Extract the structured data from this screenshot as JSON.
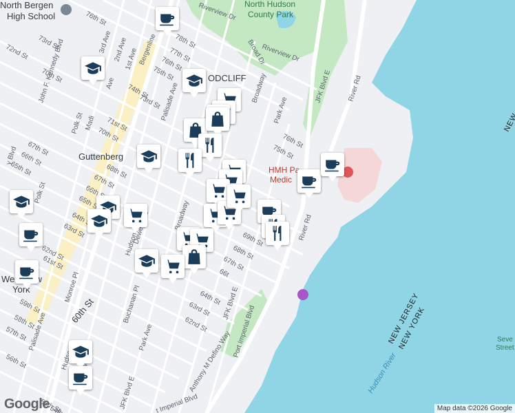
{
  "places": {
    "north_bergen_hs": "North Bergen\nHigh School",
    "north_hudson_park": "North Hudson\nCounty Park",
    "guttenberg": "Guttenberg",
    "woodcliff": "ODCLIFF",
    "west_new_york": "West New\nYork",
    "hospital": "HMH Pa\nMedic",
    "seven_street": "Seve\nStreet B"
  },
  "streets": [
    {
      "text": "76th St"
    },
    {
      "text": "Riverview Dr"
    },
    {
      "text": "Broad Dr"
    },
    {
      "text": "Riverview Dr"
    },
    {
      "text": "73rd St"
    },
    {
      "text": "72nd St"
    },
    {
      "text": "3rd Ave"
    },
    {
      "text": "2nd Ave"
    },
    {
      "text": "1st Ave"
    },
    {
      "text": "78th St"
    },
    {
      "text": "Bergenline"
    },
    {
      "text": "77th St"
    },
    {
      "text": "76th St"
    },
    {
      "text": "75th St"
    },
    {
      "text": "John F. Kennedy Blvd"
    },
    {
      "text": "71st St"
    },
    {
      "text": "70th St"
    },
    {
      "text": "Polk St"
    },
    {
      "text": "Madi"
    },
    {
      "text": "Ave"
    },
    {
      "text": "74th St"
    },
    {
      "text": "73rd St"
    },
    {
      "text": "Palisade Ave"
    },
    {
      "text": "71st St"
    },
    {
      "text": "70th St"
    },
    {
      "text": "67th St"
    },
    {
      "text": "66th St"
    },
    {
      "text": "65th St"
    },
    {
      "text": "68th St"
    },
    {
      "text": "67th St"
    },
    {
      "text": "66th St"
    },
    {
      "text": "65th St"
    },
    {
      "text": "64th St"
    },
    {
      "text": "63rd St"
    },
    {
      "text": "62nd St"
    },
    {
      "text": "61st St"
    },
    {
      "text": "60th St"
    },
    {
      "text": "59th St"
    },
    {
      "text": "58th St"
    },
    {
      "text": "57th St"
    },
    {
      "text": "56th St"
    },
    {
      "text": "55th St"
    },
    {
      "text": "54th St"
    },
    {
      "text": "Polk St"
    },
    {
      "text": "Hudson Ave"
    },
    {
      "text": "Dewey Ave"
    },
    {
      "text": "Broadway"
    },
    {
      "text": "Monroe Pl"
    },
    {
      "text": "60th St"
    },
    {
      "text": "Buchanan Pl"
    },
    {
      "text": "Park Ave"
    },
    {
      "text": "JFK Blvd E"
    },
    {
      "text": "JFK Blvd E"
    },
    {
      "text": "River Rd"
    },
    {
      "text": "River Rd"
    },
    {
      "text": "Park Ave"
    },
    {
      "text": "76th St"
    },
    {
      "text": "75th St"
    },
    {
      "text": "Broadway"
    },
    {
      "text": "69th St"
    },
    {
      "text": "68th St"
    },
    {
      "text": "67th St"
    },
    {
      "text": "66t"
    },
    {
      "text": "64th St"
    },
    {
      "text": "63rd St"
    },
    {
      "text": "62nd St"
    },
    {
      "text": "JFK Blvd E"
    },
    {
      "text": "Anthony M Defino Way"
    },
    {
      "text": "Port Imperial Blvd"
    },
    {
      "text": "Port Imperial Blvd"
    },
    {
      "text": "Palisade Ave"
    },
    {
      "text": "JFK Blvd E"
    },
    {
      "text": "Hudso"
    },
    {
      "text": "dway"
    },
    {
      "text": "y Blvd"
    },
    {
      "text": "63rd St"
    },
    {
      "text": "St"
    }
  ],
  "water": {
    "river": "Hudson River"
  },
  "state_border": {
    "nj": "NEW JERSEY",
    "ny": "NEW YORK",
    "ny_top": "NEW"
  },
  "markers": [
    {
      "type": "coffee-icon"
    },
    {
      "type": "school-icon"
    },
    {
      "type": "school-icon"
    },
    {
      "type": "shopping-cart-icon"
    },
    {
      "type": "shopping-cart-icon"
    },
    {
      "type": "shopping-cart-icon"
    },
    {
      "type": "shopping-bag-icon"
    },
    {
      "type": "shopping-bag-icon"
    },
    {
      "type": "restaurant-icon"
    },
    {
      "type": "school-icon"
    },
    {
      "type": "restaurant-icon"
    },
    {
      "type": "shopping-cart-icon"
    },
    {
      "type": "shopping-cart-icon"
    },
    {
      "type": "shopping-cart-icon"
    },
    {
      "type": "school-icon"
    },
    {
      "type": "school-icon"
    },
    {
      "type": "shopping-cart-icon"
    },
    {
      "type": "shopping-cart-icon"
    },
    {
      "type": "shopping-cart-icon"
    },
    {
      "type": "coffee-icon"
    },
    {
      "type": "coffee-icon"
    },
    {
      "type": "restaurant-icon"
    },
    {
      "type": "shopping-cart-icon"
    },
    {
      "type": "restaurant-icon"
    },
    {
      "type": "coffee-icon"
    },
    {
      "type": "coffee-icon"
    },
    {
      "type": "school-icon"
    },
    {
      "type": "shopping-cart-icon"
    },
    {
      "type": "shopping-cart-icon"
    },
    {
      "type": "shopping-bag-icon"
    },
    {
      "type": "shopping-cart-icon"
    },
    {
      "type": "coffee-icon"
    },
    {
      "type": "school-icon"
    },
    {
      "type": "school-icon"
    },
    {
      "type": "coffee-icon"
    }
  ],
  "colors": {
    "water": "#90d5e6",
    "park": "#c4e8c2",
    "land": "#eef0f3",
    "road": "#ffffff",
    "major_road": "#fbe8a6",
    "icon": "#1c3d5a"
  },
  "footer": {
    "logo": "Google",
    "attribution": "Map data ©2026 Google"
  }
}
